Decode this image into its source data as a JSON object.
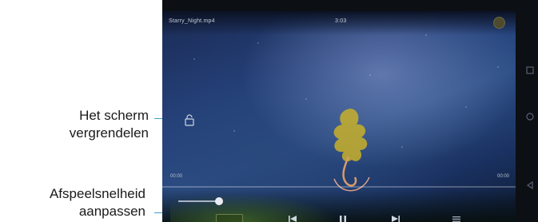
{
  "callouts": {
    "lock_line1": "Het scherm",
    "lock_line2": "vergrendelen",
    "speed_line1": "Afspeelsnelheid",
    "speed_line2": "aanpassen"
  },
  "player": {
    "file_name": "Starry_Night.mp4",
    "clock": "3:03",
    "time_elapsed": "00:00",
    "time_total": "00:00",
    "progress": 0.0,
    "speed_slider_fraction": 0.9
  },
  "icons": {
    "lock": "lock-icon",
    "prev": "skip-previous-icon",
    "pause": "pause-icon",
    "next": "skip-next-icon",
    "menu": "menu-icon",
    "settings": "settings-icon",
    "nav_square": "recent-apps-icon",
    "nav_circle": "home-icon",
    "nav_back": "back-icon"
  },
  "colors": {
    "leader": "#3fa0c8",
    "sky": "#24407a",
    "tree": "#c8b02a"
  }
}
